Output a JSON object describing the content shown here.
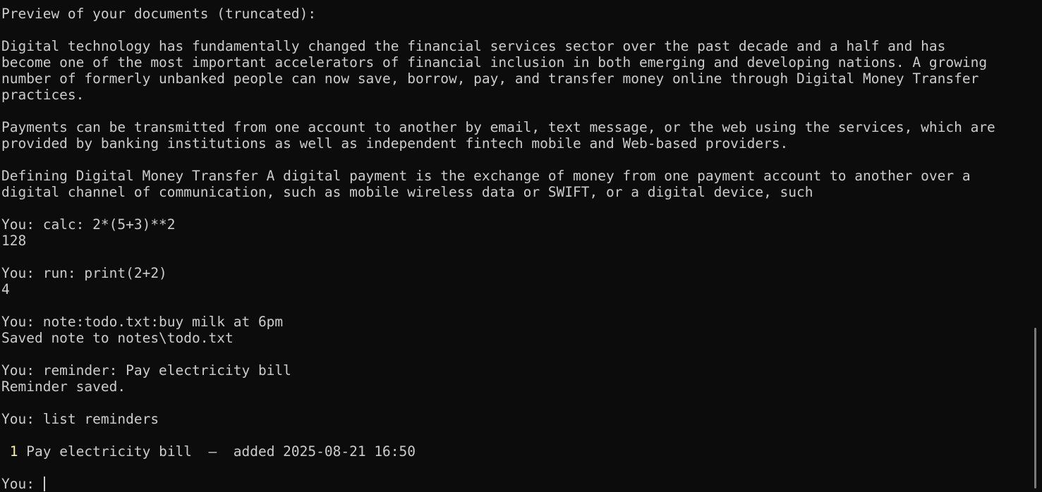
{
  "terminal": {
    "lines": [
      "Preview of your documents (truncated):",
      "",
      "Digital technology has fundamentally changed the financial services sector over the past decade and a half and has",
      "become one of the most important accelerators of financial inclusion in both emerging and developing nations. A growing",
      "number of formerly unbanked people can now save, borrow, pay, and transfer money online through Digital Money Transfer",
      "practices.",
      "",
      "Payments can be transmitted from one account to another by email, text message, or the web using the services, which are",
      "provided by banking institutions as well as independent fintech mobile and Web-based providers.",
      "",
      "Defining Digital Money Transfer A digital payment is the exchange of money from one payment account to another over a",
      "digital channel of communication, such as mobile wireless data or SWIFT, or a digital device, such",
      "",
      "You: calc: 2*(5+3)**2",
      "128",
      "",
      "You: run: print(2+2)",
      "4",
      "",
      "You: note:todo.txt:buy milk at 6pm",
      "Saved note to notes\\todo.txt",
      "",
      "You: reminder: Pay electricity bill",
      "Reminder saved.",
      "",
      "You: list reminders",
      ""
    ],
    "reminder_item": {
      "index": "1",
      "text": " Pay electricity bill  –  added 2025-08-21 16:50"
    },
    "prompt": "You: ",
    "colors": {
      "background": "#0c0c0c",
      "foreground": "#cccccc",
      "index": "#f9f1a5"
    }
  }
}
